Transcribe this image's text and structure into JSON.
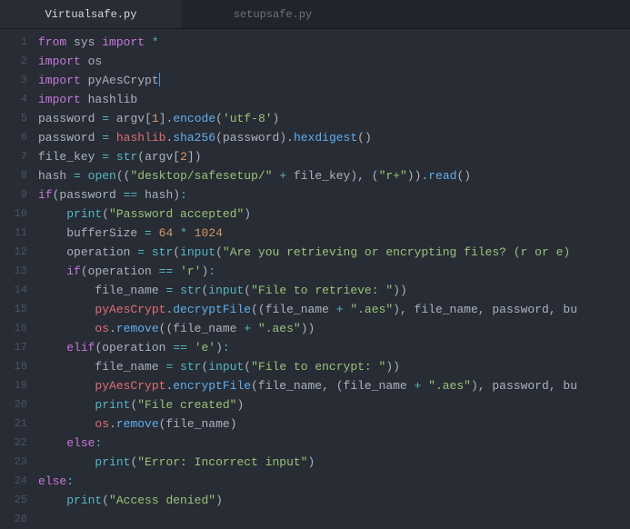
{
  "tabs": [
    {
      "label": "Virtualsafe.py",
      "active": true
    },
    {
      "label": "setupsafe.py",
      "active": false
    }
  ],
  "lines": [
    {
      "n": 1,
      "t": [
        [
          "kw",
          "from"
        ],
        [
          "sp",
          " "
        ],
        [
          "mod",
          "sys"
        ],
        [
          "sp",
          " "
        ],
        [
          "kw",
          "import"
        ],
        [
          "sp",
          " "
        ],
        [
          "op",
          "*"
        ]
      ]
    },
    {
      "n": 2,
      "t": [
        [
          "kw",
          "import"
        ],
        [
          "sp",
          " "
        ],
        [
          "mod",
          "os"
        ]
      ]
    },
    {
      "n": 3,
      "t": [
        [
          "kw",
          "import"
        ],
        [
          "sp",
          " "
        ],
        [
          "mod",
          "pyAesCrypt"
        ],
        [
          "cursor",
          ""
        ]
      ]
    },
    {
      "n": 4,
      "t": [
        [
          "kw",
          "import"
        ],
        [
          "sp",
          " "
        ],
        [
          "mod",
          "hashlib"
        ]
      ]
    },
    {
      "n": 5,
      "t": [
        [
          "obj",
          "password "
        ],
        [
          "op",
          "="
        ],
        [
          "sp",
          " "
        ],
        [
          "obj",
          "argv"
        ],
        [
          "paren",
          "["
        ],
        [
          "num",
          "1"
        ],
        [
          "paren",
          "]"
        ],
        [
          "dot",
          "."
        ],
        [
          "func",
          "encode"
        ],
        [
          "paren",
          "("
        ],
        [
          "str",
          "'utf-8'"
        ],
        [
          "paren",
          ")"
        ]
      ]
    },
    {
      "n": 6,
      "t": [
        [
          "obj",
          "password "
        ],
        [
          "op",
          "="
        ],
        [
          "sp",
          " "
        ],
        [
          "var",
          "hashlib"
        ],
        [
          "dot",
          "."
        ],
        [
          "func",
          "sha256"
        ],
        [
          "paren",
          "("
        ],
        [
          "obj",
          "password"
        ],
        [
          "paren",
          ")"
        ],
        [
          "dot",
          "."
        ],
        [
          "func",
          "hexdigest"
        ],
        [
          "paren",
          "()"
        ]
      ]
    },
    {
      "n": 7,
      "t": [
        [
          "obj",
          "file_key "
        ],
        [
          "op",
          "="
        ],
        [
          "sp",
          " "
        ],
        [
          "builtin",
          "str"
        ],
        [
          "paren",
          "("
        ],
        [
          "obj",
          "argv"
        ],
        [
          "paren",
          "["
        ],
        [
          "num",
          "2"
        ],
        [
          "paren",
          "])"
        ]
      ]
    },
    {
      "n": 8,
      "t": [
        [
          "obj",
          "hash "
        ],
        [
          "op",
          "="
        ],
        [
          "sp",
          " "
        ],
        [
          "builtin",
          "open"
        ],
        [
          "paren",
          "(("
        ],
        [
          "str",
          "\"desktop/safesetup/\""
        ],
        [
          "sp",
          " "
        ],
        [
          "op",
          "+"
        ],
        [
          "sp",
          " "
        ],
        [
          "obj",
          "file_key"
        ],
        [
          "paren",
          "), ("
        ],
        [
          "str",
          "\"r+\""
        ],
        [
          "paren",
          "))"
        ],
        [
          "dot",
          "."
        ],
        [
          "func",
          "read"
        ],
        [
          "paren",
          "()"
        ]
      ]
    },
    {
      "n": 9,
      "t": [
        [
          "kw",
          "if"
        ],
        [
          "paren",
          "("
        ],
        [
          "obj",
          "password "
        ],
        [
          "op",
          "=="
        ],
        [
          "sp",
          " "
        ],
        [
          "obj",
          "hash"
        ],
        [
          "paren",
          ")"
        ],
        [
          "op",
          ":"
        ]
      ]
    },
    {
      "n": 10,
      "t": [
        [
          "sp",
          "    "
        ],
        [
          "builtin",
          "print"
        ],
        [
          "paren",
          "("
        ],
        [
          "str",
          "\"Password accepted\""
        ],
        [
          "paren",
          ")"
        ]
      ]
    },
    {
      "n": 11,
      "t": [
        [
          "sp",
          "    "
        ],
        [
          "obj",
          "bufferSize "
        ],
        [
          "op",
          "="
        ],
        [
          "sp",
          " "
        ],
        [
          "num",
          "64"
        ],
        [
          "sp",
          " "
        ],
        [
          "op",
          "*"
        ],
        [
          "sp",
          " "
        ],
        [
          "num",
          "1024"
        ]
      ]
    },
    {
      "n": 12,
      "t": [
        [
          "sp",
          "    "
        ],
        [
          "obj",
          "operation "
        ],
        [
          "op",
          "="
        ],
        [
          "sp",
          " "
        ],
        [
          "builtin",
          "str"
        ],
        [
          "paren",
          "("
        ],
        [
          "builtin",
          "input"
        ],
        [
          "paren",
          "("
        ],
        [
          "str",
          "\"Are you retrieving or encrypting files? (r or e)"
        ]
      ]
    },
    {
      "n": 13,
      "t": [
        [
          "sp",
          "    "
        ],
        [
          "kw",
          "if"
        ],
        [
          "paren",
          "("
        ],
        [
          "obj",
          "operation "
        ],
        [
          "op",
          "=="
        ],
        [
          "sp",
          " "
        ],
        [
          "str",
          "'r'"
        ],
        [
          "paren",
          ")"
        ],
        [
          "op",
          ":"
        ]
      ]
    },
    {
      "n": 14,
      "t": [
        [
          "sp",
          "        "
        ],
        [
          "obj",
          "file_name "
        ],
        [
          "op",
          "="
        ],
        [
          "sp",
          " "
        ],
        [
          "builtin",
          "str"
        ],
        [
          "paren",
          "("
        ],
        [
          "builtin",
          "input"
        ],
        [
          "paren",
          "("
        ],
        [
          "str",
          "\"File to retrieve: \""
        ],
        [
          "paren",
          "))"
        ]
      ]
    },
    {
      "n": 15,
      "t": [
        [
          "sp",
          "        "
        ],
        [
          "var",
          "pyAesCrypt"
        ],
        [
          "dot",
          "."
        ],
        [
          "func",
          "decryptFile"
        ],
        [
          "paren",
          "(("
        ],
        [
          "obj",
          "file_name "
        ],
        [
          "op",
          "+"
        ],
        [
          "sp",
          " "
        ],
        [
          "str",
          "\".aes\""
        ],
        [
          "paren",
          "), "
        ],
        [
          "obj",
          "file_name"
        ],
        [
          "paren",
          ", "
        ],
        [
          "obj",
          "password"
        ],
        [
          "paren",
          ", "
        ],
        [
          "obj",
          "bu"
        ]
      ]
    },
    {
      "n": 16,
      "t": [
        [
          "sp",
          "        "
        ],
        [
          "var",
          "os"
        ],
        [
          "dot",
          "."
        ],
        [
          "func",
          "remove"
        ],
        [
          "paren",
          "(("
        ],
        [
          "obj",
          "file_name "
        ],
        [
          "op",
          "+"
        ],
        [
          "sp",
          " "
        ],
        [
          "str",
          "\".aes\""
        ],
        [
          "paren",
          "))"
        ]
      ]
    },
    {
      "n": 17,
      "t": [
        [
          "sp",
          "    "
        ],
        [
          "kw",
          "elif"
        ],
        [
          "paren",
          "("
        ],
        [
          "obj",
          "operation "
        ],
        [
          "op",
          "=="
        ],
        [
          "sp",
          " "
        ],
        [
          "str",
          "'e'"
        ],
        [
          "paren",
          ")"
        ],
        [
          "op",
          ":"
        ]
      ]
    },
    {
      "n": 18,
      "t": [
        [
          "sp",
          "        "
        ],
        [
          "obj",
          "file_name "
        ],
        [
          "op",
          "="
        ],
        [
          "sp",
          " "
        ],
        [
          "builtin",
          "str"
        ],
        [
          "paren",
          "("
        ],
        [
          "builtin",
          "input"
        ],
        [
          "paren",
          "("
        ],
        [
          "str",
          "\"File to encrypt: \""
        ],
        [
          "paren",
          "))"
        ]
      ]
    },
    {
      "n": 19,
      "t": [
        [
          "sp",
          "        "
        ],
        [
          "var",
          "pyAesCrypt"
        ],
        [
          "dot",
          "."
        ],
        [
          "func",
          "encryptFile"
        ],
        [
          "paren",
          "("
        ],
        [
          "obj",
          "file_name"
        ],
        [
          "paren",
          ", ("
        ],
        [
          "obj",
          "file_name "
        ],
        [
          "op",
          "+"
        ],
        [
          "sp",
          " "
        ],
        [
          "str",
          "\".aes\""
        ],
        [
          "paren",
          "), "
        ],
        [
          "obj",
          "password"
        ],
        [
          "paren",
          ", "
        ],
        [
          "obj",
          "bu"
        ]
      ]
    },
    {
      "n": 20,
      "t": [
        [
          "sp",
          "        "
        ],
        [
          "builtin",
          "print"
        ],
        [
          "paren",
          "("
        ],
        [
          "str",
          "\"File created\""
        ],
        [
          "paren",
          ")"
        ]
      ]
    },
    {
      "n": 21,
      "t": [
        [
          "sp",
          "        "
        ],
        [
          "var",
          "os"
        ],
        [
          "dot",
          "."
        ],
        [
          "func",
          "remove"
        ],
        [
          "paren",
          "("
        ],
        [
          "obj",
          "file_name"
        ],
        [
          "paren",
          ")"
        ]
      ]
    },
    {
      "n": 22,
      "t": [
        [
          "sp",
          "    "
        ],
        [
          "kw",
          "else"
        ],
        [
          "op",
          ":"
        ]
      ]
    },
    {
      "n": 23,
      "t": [
        [
          "sp",
          "        "
        ],
        [
          "builtin",
          "print"
        ],
        [
          "paren",
          "("
        ],
        [
          "str",
          "\"Error: Incorrect input\""
        ],
        [
          "paren",
          ")"
        ]
      ]
    },
    {
      "n": 24,
      "t": [
        [
          "kw",
          "else"
        ],
        [
          "op",
          ":"
        ]
      ]
    },
    {
      "n": 25,
      "t": [
        [
          "sp",
          "    "
        ],
        [
          "builtin",
          "print"
        ],
        [
          "paren",
          "("
        ],
        [
          "str",
          "\"Access denied\""
        ],
        [
          "paren",
          ")"
        ]
      ]
    },
    {
      "n": 26,
      "t": []
    }
  ]
}
